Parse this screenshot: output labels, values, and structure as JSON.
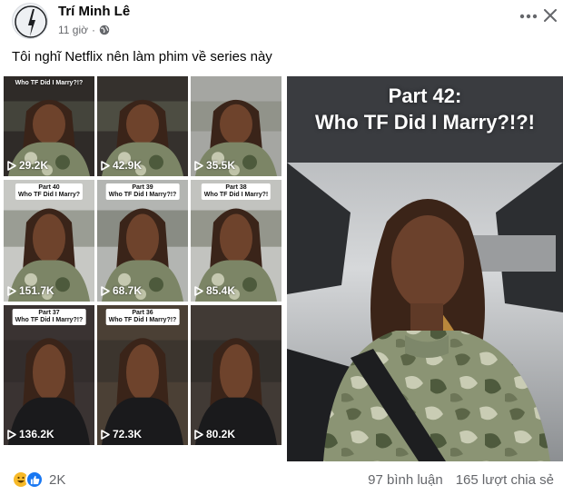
{
  "post": {
    "author": "Trí Minh Lê",
    "time": "11 giờ",
    "dot": "·",
    "caption": "Tôi nghĩ Netflix nên làm phim về series này"
  },
  "grid": [
    {
      "views": "29.2K",
      "label": ""
    },
    {
      "views": "42.9K",
      "label": ""
    },
    {
      "views": "35.5K",
      "label": ""
    },
    {
      "views": "151.7K",
      "label": "Part 40\nWho TF Did I Marry?"
    },
    {
      "views": "68.7K",
      "label": "Part 39\nWho TF Did I Marry?!?"
    },
    {
      "views": "85.4K",
      "label": "Part 38\nWho TF Did I Marry?!"
    },
    {
      "views": "136.2K",
      "label": "Part 37\nWho TF Did I Marry?!?"
    },
    {
      "views": "72.3K",
      "label": "Part 36\nWho TF Did I Marry?!?"
    },
    {
      "views": "80.2K",
      "label": ""
    }
  ],
  "top_label": "Who TF Did I Marry?!?",
  "featured": {
    "title_line1": "Part 42:",
    "title_line2": "Who TF Did I Marry?!?!"
  },
  "footer": {
    "reaction_count": "2K",
    "comments": "97 bình luận",
    "shares": "165 lượt chia sẻ"
  },
  "icons": {
    "avatar": "avatar-silhouette",
    "privacy": "globe-icon",
    "more": "more-icon",
    "close": "close-icon",
    "play": "play-icon",
    "haha": "haha-reaction-icon",
    "like": "like-reaction-icon"
  },
  "colors": {
    "meta_text": "#65676b",
    "like_blue": "#1877f2",
    "haha_yellow": "#f7b928"
  }
}
